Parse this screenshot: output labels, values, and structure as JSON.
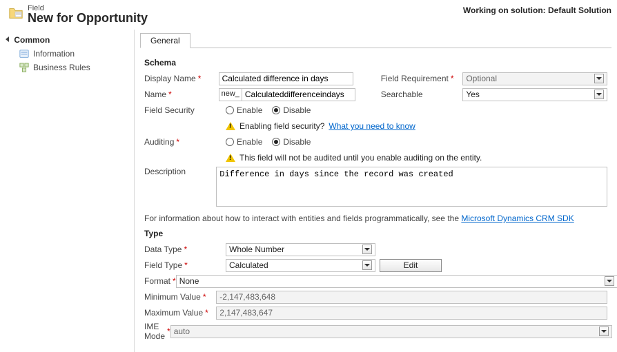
{
  "header": {
    "small": "Field",
    "large": "New for Opportunity",
    "rightPrefix": "Working on solution: ",
    "rightSolution": "Default Solution"
  },
  "sidebar": {
    "groupTitle": "Common",
    "items": [
      {
        "label": "Information"
      },
      {
        "label": "Business Rules"
      }
    ]
  },
  "tab": {
    "general": "General"
  },
  "schema": {
    "title": "Schema",
    "displayNameLabel": "Display Name",
    "displayNameValue": "Calculated difference in days",
    "fieldReqLabel": "Field Requirement",
    "fieldReqValue": "Optional",
    "nameLabel": "Name",
    "namePrefix": "new_",
    "nameValue": "Calculateddifferenceindays",
    "searchableLabel": "Searchable",
    "searchableValue": "Yes",
    "fieldSecurityLabel": "Field Security",
    "enable": "Enable",
    "disable": "Disable",
    "securityWarnText": "Enabling field security? ",
    "securityWarnLink": "What you need to know",
    "auditingLabel": "Auditing",
    "auditingWarn": "This field will not be audited until you enable auditing on the entity.",
    "descriptionLabel": "Description",
    "descriptionValue": "Difference in days since the record was created",
    "infoText": "For information about how to interact with entities and fields programmatically, see the ",
    "infoLink": "Microsoft Dynamics CRM SDK"
  },
  "type": {
    "title": "Type",
    "dataTypeLabel": "Data Type",
    "dataTypeValue": "Whole Number",
    "fieldTypeLabel": "Field Type",
    "fieldTypeValue": "Calculated",
    "editBtn": "Edit",
    "formatLabel": "Format",
    "formatValue": "None",
    "minLabel": "Minimum Value",
    "minValue": "-2,147,483,648",
    "maxLabel": "Maximum Value",
    "maxValue": "2,147,483,647",
    "imeLabel": "IME Mode",
    "imeValue": "auto"
  }
}
